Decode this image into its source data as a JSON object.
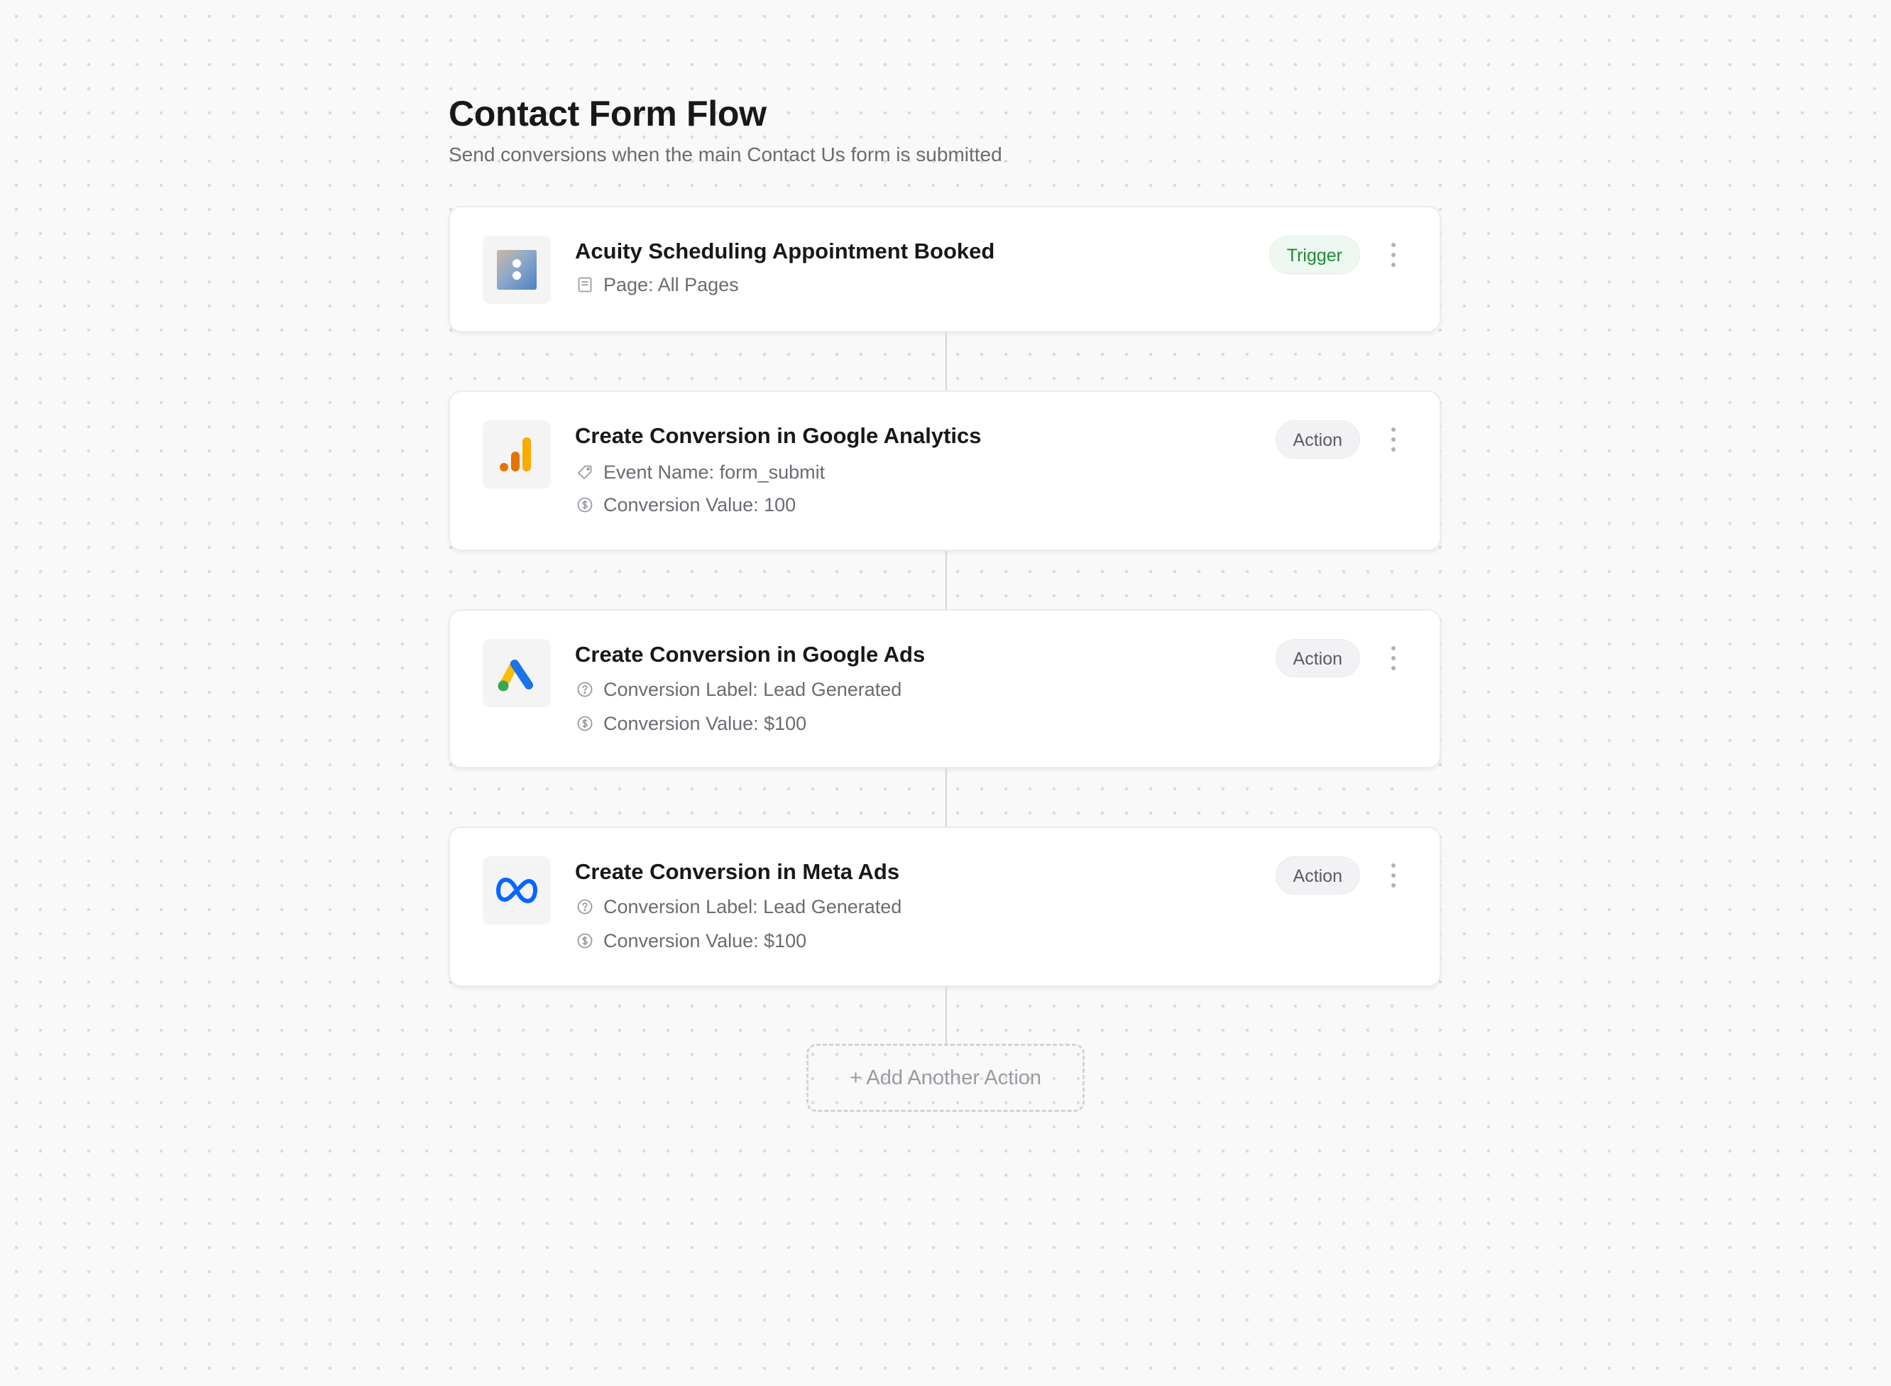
{
  "flow": {
    "title": "Contact Form Flow",
    "subtitle": "Send conversions when the main Contact Us form is submitted"
  },
  "steps": [
    {
      "title": "Acuity Scheduling Appointment Booked",
      "badge": "Trigger",
      "logo": "acuity-scheduling-logo",
      "details": [
        {
          "icon": "page-icon",
          "text": "Page: All Pages"
        }
      ]
    },
    {
      "title": "Create Conversion in Google Analytics",
      "badge": "Action",
      "logo": "google-analytics-logo",
      "details": [
        {
          "icon": "tag-icon",
          "text": "Event Name: form_submit"
        },
        {
          "icon": "dollar-circle-icon",
          "text": "Conversion Value: 100"
        }
      ]
    },
    {
      "title": "Create Conversion in Google Ads",
      "badge": "Action",
      "logo": "google-ads-logo",
      "details": [
        {
          "icon": "help-circle-icon",
          "text": "Conversion Label: Lead Generated"
        },
        {
          "icon": "dollar-circle-icon",
          "text": "Conversion Value: $100"
        }
      ]
    },
    {
      "title": "Create Conversion in Meta Ads",
      "badge": "Action",
      "logo": "meta-logo",
      "details": [
        {
          "icon": "help-circle-icon",
          "text": "Conversion Label: Lead Generated"
        },
        {
          "icon": "dollar-circle-icon",
          "text": "Conversion Value: $100"
        }
      ]
    }
  ],
  "add_action": {
    "label": "+ Add Another Action"
  },
  "colors": {
    "trigger_badge_text": "#1f8a3a",
    "trigger_badge_bg": "#eef7f0",
    "action_badge_bg": "#f2f2f4",
    "google_ads_blue": "#1a73e8",
    "google_ads_yellow": "#fbbc04",
    "google_ads_green": "#34a853",
    "analytics_orange": "#f9ab00",
    "analytics_dark_orange": "#e37400",
    "meta_blue": "#0866ff"
  }
}
